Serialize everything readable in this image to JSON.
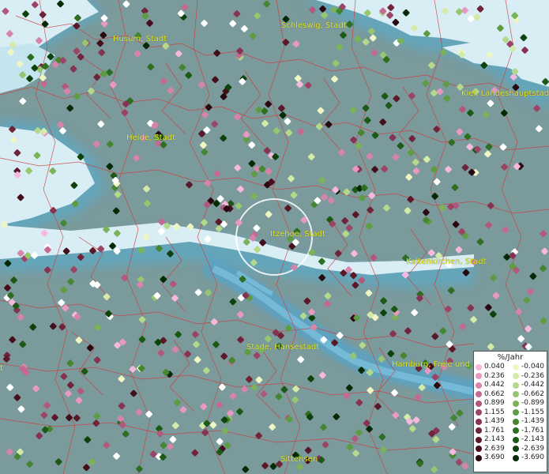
{
  "cities": [
    {
      "id": "husum",
      "label": "Husum, Stadt"
    },
    {
      "id": "schleswig",
      "label": "Schleswig, Stadt"
    },
    {
      "id": "kiel",
      "label": "Kiel, Landeshauptstadt"
    },
    {
      "id": "heide",
      "label": "Heide, Stadt"
    },
    {
      "id": "itzehoe",
      "label": "Itzehoe, Stadt"
    },
    {
      "id": "kaltenkirchen",
      "label": "Kaltenkirchen, Stadt"
    },
    {
      "id": "stade",
      "label": "Stade, Hansestadt"
    },
    {
      "id": "hamburg",
      "label": "Hamburg, Freie und H"
    },
    {
      "id": "sittensen",
      "label": "Sittensen"
    },
    {
      "id": "left-edge",
      "label": "t"
    }
  ],
  "legend": {
    "title": "%/Jahr",
    "positive": [
      {
        "value": "0.040",
        "color": "#f6b8dc"
      },
      {
        "value": "0.236",
        "color": "#e899c2"
      },
      {
        "value": "0.442",
        "color": "#d784aa"
      },
      {
        "value": "0.662",
        "color": "#c46a92"
      },
      {
        "value": "0.899",
        "color": "#b2587c"
      },
      {
        "value": "1.155",
        "color": "#9c4466"
      },
      {
        "value": "1.439",
        "color": "#873250"
      },
      {
        "value": "1.761",
        "color": "#70243a"
      },
      {
        "value": "2.143",
        "color": "#5a1828"
      },
      {
        "value": "2.639",
        "color": "#440e1a"
      },
      {
        "value": "3.690",
        "color": "#2a0810"
      }
    ],
    "negative": [
      {
        "value": "-0.040",
        "color": "#eef6c4"
      },
      {
        "value": "-0.236",
        "color": "#d4eaa8"
      },
      {
        "value": "-0.442",
        "color": "#b4d98a"
      },
      {
        "value": "-0.662",
        "color": "#96c670"
      },
      {
        "value": "-0.899",
        "color": "#7bb35a"
      },
      {
        "value": "-1.155",
        "color": "#5e9c44"
      },
      {
        "value": "-1.439",
        "color": "#468632"
      },
      {
        "value": "-1.761",
        "color": "#2e6e22"
      },
      {
        "value": "-2.143",
        "color": "#1c5816"
      },
      {
        "value": "-2.639",
        "color": "#0e420c"
      },
      {
        "value": "-3.690",
        "color": "#062a06"
      }
    ]
  }
}
